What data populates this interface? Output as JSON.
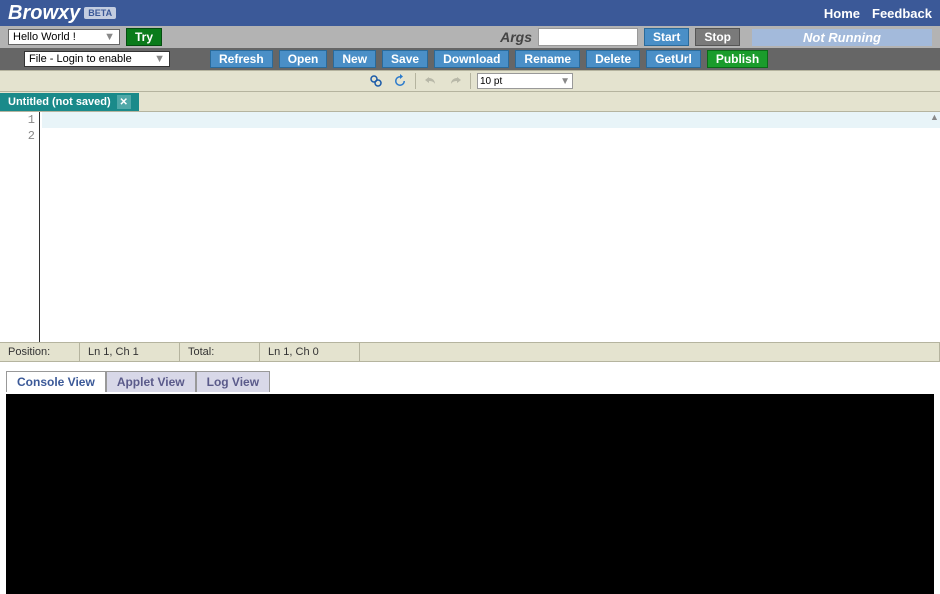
{
  "header": {
    "logo": "Browxy",
    "beta": "BETA",
    "links": {
      "home": "Home",
      "feedback": "Feedback"
    }
  },
  "toolbar1": {
    "program_select": "Hello World !",
    "try": "Try",
    "args_label": "Args",
    "args_value": "",
    "start": "Start",
    "stop": "Stop",
    "status": "Not Running"
  },
  "toolbar2": {
    "file_menu": "File - Login to enable",
    "refresh": "Refresh",
    "open": "Open",
    "new": "New",
    "save": "Save",
    "download": "Download",
    "rename": "Rename",
    "delete": "Delete",
    "geturl": "GetUrl",
    "publish": "Publish"
  },
  "toolbar3": {
    "font_size": "10 pt"
  },
  "tabs": {
    "file": "Untitled (not saved)"
  },
  "editor": {
    "line1": "1",
    "line2": "2"
  },
  "statusbar": {
    "pos_label": "Position:",
    "pos_value": "Ln 1, Ch 1",
    "total_label": "Total:",
    "total_value": "Ln 1, Ch 0"
  },
  "output_tabs": {
    "console": "Console View",
    "applet": "Applet View",
    "log": "Log View"
  }
}
